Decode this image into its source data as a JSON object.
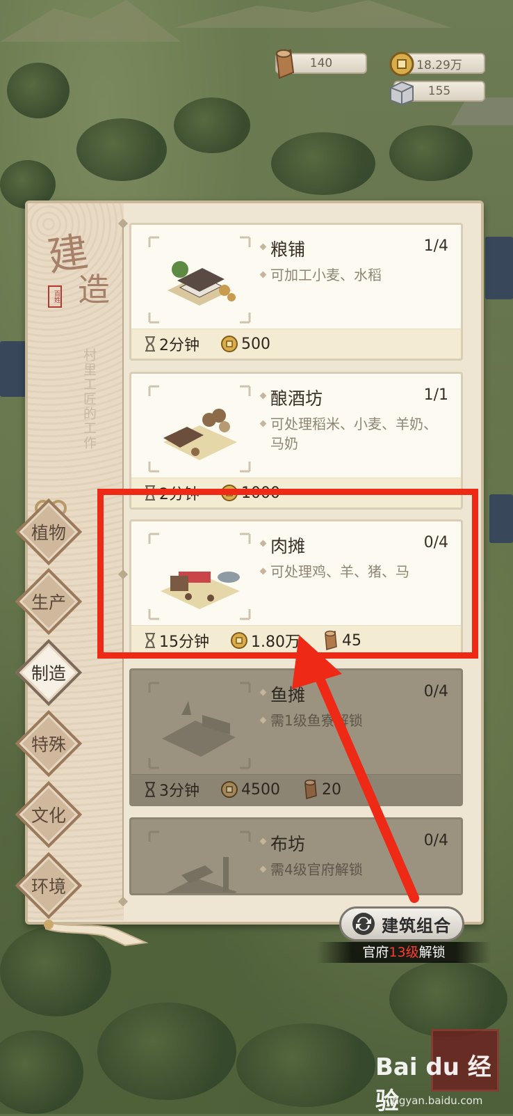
{
  "resources": [
    {
      "icon": "wood-log-icon",
      "value": "140"
    },
    {
      "icon": "copper-coin-icon",
      "value": "18.29万"
    },
    {
      "icon": "stone-block-icon",
      "value": "155"
    }
  ],
  "panel": {
    "title_char_1": "建",
    "title_char_2": "造",
    "title_stamp": "百姓",
    "subtitle": "村里工匠的工作"
  },
  "categories": [
    {
      "label": "植物",
      "active": false
    },
    {
      "label": "生产",
      "active": false
    },
    {
      "label": "制造",
      "active": true
    },
    {
      "label": "特殊",
      "active": false
    },
    {
      "label": "文化",
      "active": false
    },
    {
      "label": "环境",
      "active": false
    }
  ],
  "buildings": [
    {
      "name": "粮铺",
      "count": "1/4",
      "desc": "可加工小麦、水稻",
      "time": "2分钟",
      "coins": "500",
      "wood": "",
      "locked": false
    },
    {
      "name": "酿酒坊",
      "count": "1/1",
      "desc": "可处理稻米、小麦、羊奶、马奶",
      "time": "2分钟",
      "coins": "1000",
      "wood": "",
      "locked": false
    },
    {
      "name": "肉摊",
      "count": "0/4",
      "desc": "可处理鸡、羊、猪、马",
      "time": "15分钟",
      "coins": "1.80万",
      "wood": "45",
      "locked": false
    },
    {
      "name": "鱼摊",
      "count": "0/4",
      "desc": "需1级鱼寮解锁",
      "time": "3分钟",
      "coins": "4500",
      "wood": "20",
      "locked": true
    },
    {
      "name": "布坊",
      "count": "0/4",
      "desc": "需4级官府解锁",
      "time": "",
      "coins": "",
      "wood": "",
      "locked": true
    }
  ],
  "combo_button": {
    "label": "建筑组合"
  },
  "unlock_tip": {
    "prefix": "官府",
    "level": "13级",
    "suffix": "解锁"
  },
  "watermark": {
    "brand": "Bai du 经验",
    "url": "jingyan.baidu.com"
  },
  "annotation": {
    "color": "#ee2a17"
  }
}
